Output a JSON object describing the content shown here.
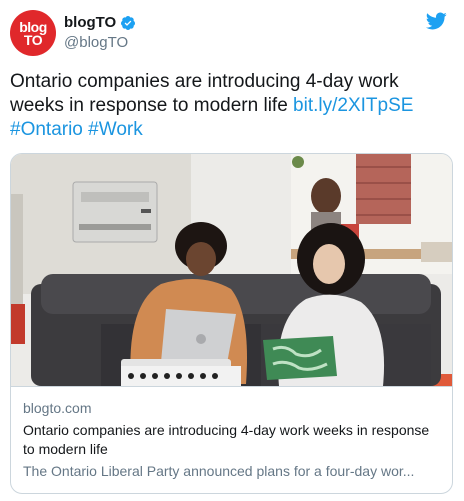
{
  "account": {
    "avatar_line1": "blog",
    "avatar_line2": "TO",
    "display_name": "blogTO",
    "handle": "@blogTO",
    "verified": true
  },
  "tweet": {
    "text": "Ontario companies are introducing 4-day work weeks in response to modern life",
    "link": "bit.ly/2XITpSE",
    "hashtags": [
      "#Ontario",
      "#Work"
    ]
  },
  "card": {
    "domain": "blogto.com",
    "title": "Ontario companies are introducing 4-day work weeks in response to modern life",
    "description": "The Ontario Liberal Party announced plans for a four-day wor..."
  },
  "icons": {
    "brand": "twitter-bird-icon",
    "verified": "verified-badge-icon"
  },
  "colors": {
    "brand": "#1da1f2",
    "link": "#1b95e0",
    "avatar_bg": "#e0282b",
    "muted": "#657786",
    "border": "#ccd6dd"
  }
}
